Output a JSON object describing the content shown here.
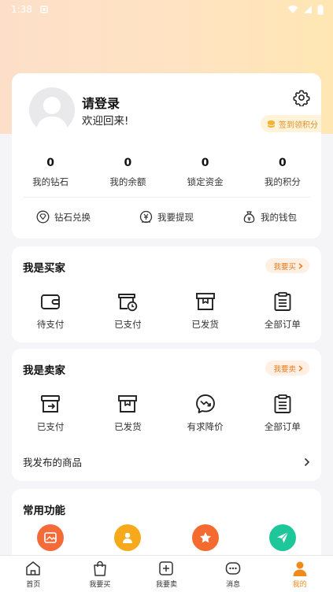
{
  "status_bar": {
    "time": "1:38"
  },
  "profile": {
    "login_title": "请登录",
    "welcome_text": "欢迎回来!",
    "checkin_label": "签到领积分",
    "stats": [
      {
        "value": "0",
        "label": "我的钻石"
      },
      {
        "value": "0",
        "label": "我的余额"
      },
      {
        "value": "0",
        "label": "锁定资金"
      },
      {
        "value": "0",
        "label": "我的积分"
      }
    ],
    "actions": [
      {
        "label": "钻石兑换",
        "icon": "diamond-icon"
      },
      {
        "label": "我要提现",
        "icon": "withdraw-icon"
      },
      {
        "label": "我的钱包",
        "icon": "wallet-bag-icon"
      }
    ]
  },
  "buyer": {
    "title": "我是买家",
    "pill_label": "我要买",
    "items": [
      {
        "label": "待支付",
        "icon": "wallet-icon"
      },
      {
        "label": "已支付",
        "icon": "paid-clock-icon"
      },
      {
        "label": "已发货",
        "icon": "package-icon"
      },
      {
        "label": "全部订单",
        "icon": "order-list-icon"
      }
    ]
  },
  "seller": {
    "title": "我是卖家",
    "pill_label": "我要卖",
    "items": [
      {
        "label": "已支付",
        "icon": "paid-box-icon"
      },
      {
        "label": "已发货",
        "icon": "package-icon"
      },
      {
        "label": "有求降价",
        "icon": "price-drop-icon"
      },
      {
        "label": "全部订单",
        "icon": "order-list-icon"
      }
    ],
    "my_goods_label": "我发布的商品"
  },
  "common": {
    "title": "常用功能",
    "items": [
      {
        "icon": "image-icon",
        "color": "#f46b3a"
      },
      {
        "icon": "user-icon",
        "color": "#f6a91a"
      },
      {
        "icon": "star-icon",
        "color": "#f56a2e"
      },
      {
        "icon": "send-icon",
        "color": "#1ec79a"
      }
    ]
  },
  "nav": {
    "items": [
      {
        "label": "首页",
        "icon": "home-icon"
      },
      {
        "label": "我要买",
        "icon": "bag-icon"
      },
      {
        "label": "我要卖",
        "icon": "plus-icon"
      },
      {
        "label": "消息",
        "icon": "message-icon"
      },
      {
        "label": "我的",
        "icon": "person-icon",
        "active": true
      }
    ]
  },
  "colors": {
    "accent": "#f08a1c",
    "pill_text": "#e67e22"
  }
}
